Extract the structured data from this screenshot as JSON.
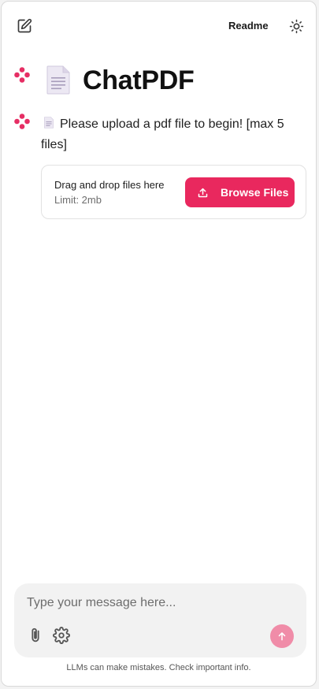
{
  "header": {
    "readme_label": "Readme",
    "new_chat_icon": "edit-icon",
    "theme_icon": "sun-icon"
  },
  "chat": {
    "title": "ChatPDF",
    "title_icon": "document-icon",
    "assistant_avatar_icon": "assistant-logo-icon",
    "welcome_message": "Please upload a pdf file to begin! [max 5 files]"
  },
  "uploader": {
    "drop_label": "Drag and drop files here",
    "limit_label": "Limit: 2mb",
    "browse_label": "Browse Files",
    "browse_icon": "upload-icon"
  },
  "composer": {
    "placeholder": "Type your message here...",
    "value": "",
    "attach_icon": "paperclip-icon",
    "settings_icon": "gear-icon",
    "send_icon": "arrow-up-icon"
  },
  "footer": {
    "disclaimer": "LLMs can make mistakes. Check important info."
  },
  "colors": {
    "accent": "#e9285e",
    "send_disabled": "#f08ca8",
    "logo": "#e62e64",
    "composer_bg": "#f2f2f2"
  }
}
